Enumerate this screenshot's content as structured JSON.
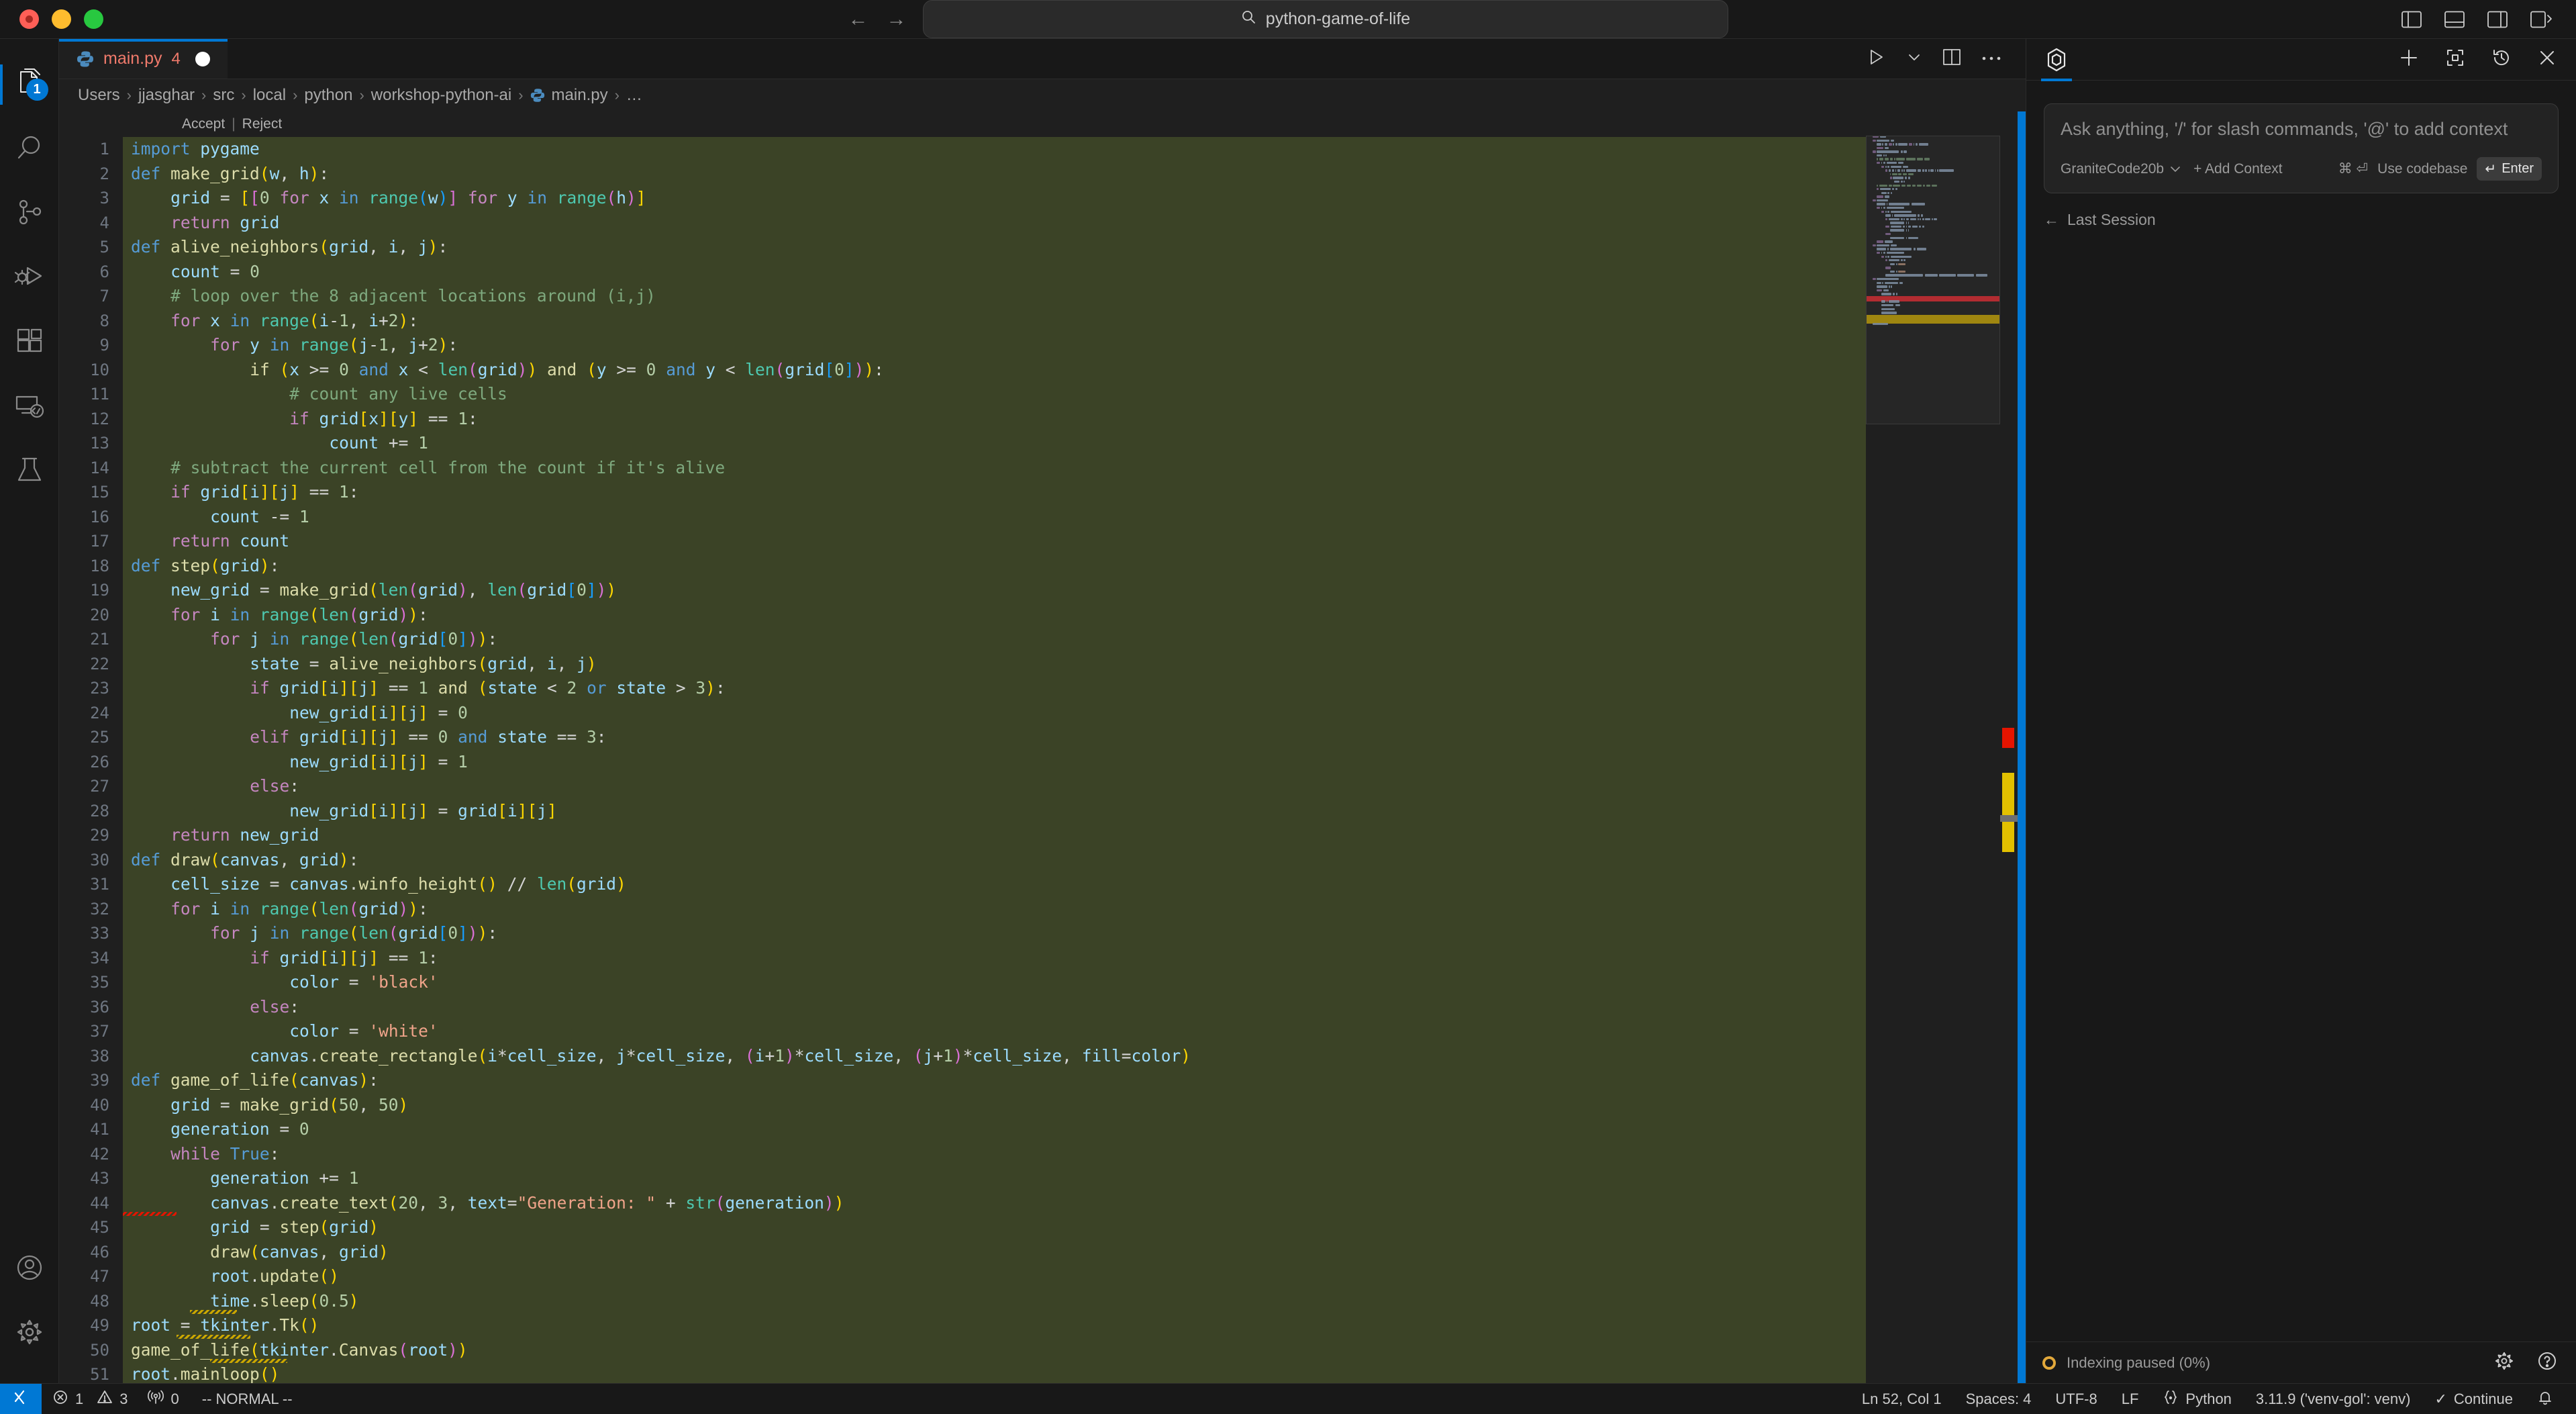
{
  "window": {
    "search_placeholder": "python-game-of-life",
    "search_icon": "search-icon",
    "nav_back": "←",
    "nav_forward": "→",
    "layout_icons": [
      "toggle-primary-sidebar-icon",
      "toggle-panel-icon",
      "toggle-secondary-sidebar-icon",
      "customize-layout-icon"
    ]
  },
  "activity_bar": {
    "items": [
      {
        "name": "explorer",
        "icon": "files-icon",
        "badge": "1",
        "active": true
      },
      {
        "name": "search",
        "icon": "search-icon",
        "badge": "",
        "active": false
      },
      {
        "name": "source-control",
        "icon": "source-control-icon",
        "badge": "",
        "active": false
      },
      {
        "name": "run-and-debug",
        "icon": "run-debug-icon",
        "badge": "",
        "active": false
      },
      {
        "name": "extensions",
        "icon": "extensions-icon",
        "badge": "",
        "active": false
      },
      {
        "name": "remote-explorer",
        "icon": "remote-icon",
        "badge": "",
        "active": false
      },
      {
        "name": "testing",
        "icon": "beaker-icon",
        "badge": "",
        "active": false
      }
    ],
    "bottom_items": [
      {
        "name": "accounts",
        "icon": "account-icon"
      },
      {
        "name": "manage",
        "icon": "gear-icon"
      }
    ]
  },
  "tabs": {
    "items": [
      {
        "label": "main.py",
        "icon": "python-file-icon",
        "error_count": "4",
        "dirty": true,
        "active": true
      }
    ],
    "actions": [
      "run-python-file-icon",
      "chevron-down-icon",
      "split-editor-icon",
      "more-actions-icon"
    ]
  },
  "breadcrumb": {
    "segments": [
      "Users",
      "jjasghar",
      "src",
      "local",
      "python",
      "workshop-python-ai",
      "main.py",
      "…"
    ],
    "separator": "›",
    "file_icon": "python-file-icon"
  },
  "inline_diff": {
    "accept_label": "Accept",
    "separator": "|",
    "reject_label": "Reject"
  },
  "editor": {
    "language": "Python",
    "first_line": 1,
    "lines": [
      "import pygame",
      "def make_grid(w, h):",
      "    grid = [[0 for x in range(w)] for y in range(h)]",
      "    return grid",
      "def alive_neighbors(grid, i, j):",
      "    count = 0",
      "    # loop over the 8 adjacent locations around (i,j)",
      "    for x in range(i-1, i+2):",
      "        for y in range(j-1, j+2):",
      "            if (x >= 0 and x < len(grid)) and (y >= 0 and y < len(grid[0])):",
      "                # count any live cells",
      "                if grid[x][y] == 1:",
      "                    count += 1",
      "    # subtract the current cell from the count if it's alive",
      "    if grid[i][j] == 1:",
      "        count -= 1",
      "    return count",
      "def step(grid):",
      "    new_grid = make_grid(len(grid), len(grid[0]))",
      "    for i in range(len(grid)):",
      "        for j in range(len(grid[0])):",
      "            state = alive_neighbors(grid, i, j)",
      "            if grid[i][j] == 1 and (state < 2 or state > 3):",
      "                new_grid[i][j] = 0",
      "            elif grid[i][j] == 0 and state == 3:",
      "                new_grid[i][j] = 1",
      "            else:",
      "                new_grid[i][j] = grid[i][j]",
      "    return new_grid",
      "def draw(canvas, grid):",
      "    cell_size = canvas.winfo_height() // len(grid)",
      "    for i in range(len(grid)):",
      "        for j in range(len(grid[0])):",
      "            if grid[i][j] == 1:",
      "                color = 'black'",
      "            else:",
      "                color = 'white'",
      "            canvas.create_rectangle(i*cell_size, j*cell_size, (i+1)*cell_size, (j+1)*cell_size, fill=color)",
      "def game_of_life(canvas):",
      "    grid = make_grid(50, 50)",
      "    generation = 0",
      "    while True:",
      "        generation += 1",
      "        canvas.create_text(20, 3, text=\"Generation: \" + str(generation))",
      "        grid = step(grid)",
      "        draw(canvas, grid)",
      "        root.update()",
      "        time.sleep(0.5)",
      "root = tkinter.Tk()",
      "game_of_life(tkinter.Canvas(root))",
      "root.mainloop()"
    ]
  },
  "side_panel": {
    "title_icon": "continue-logo-icon",
    "actions": [
      "new-session-icon",
      "fullscreen-icon",
      "history-icon",
      "close-icon"
    ],
    "ask_placeholder": "Ask anything, '/' for slash commands, '@' to add context",
    "model_name": "GraniteCode20b",
    "model_chevron": "⌄",
    "add_context_label": "+ Add Context",
    "use_codebase_label": "Use codebase",
    "use_codebase_keys": "⌘ ⏎",
    "enter_label": "Enter",
    "enter_key_icon": "↵",
    "last_session_label": "Last Session",
    "last_session_arrow": "←",
    "indexing_status": "Indexing paused (0%)",
    "footer_icons": [
      "gear-icon",
      "help-icon"
    ]
  },
  "status_bar": {
    "remote_icon": "remote-window-icon",
    "errors_icon": "error-icon",
    "errors": "1",
    "warnings_icon": "warning-icon",
    "warnings": "3",
    "ports_icon": "ports-icon",
    "ports": "0",
    "vim_mode": "-- NORMAL --",
    "cursor_position": "Ln 52, Col 1",
    "indentation": "Spaces: 4",
    "encoding": "UTF-8",
    "eol": "LF",
    "language_icon": "python-brackets-icon",
    "language": "Python",
    "interpreter": "3.11.9 ('venv-gol': venv)",
    "continue_icon": "✓",
    "continue_label": "Continue",
    "notifications_icon": "bell-icon"
  }
}
